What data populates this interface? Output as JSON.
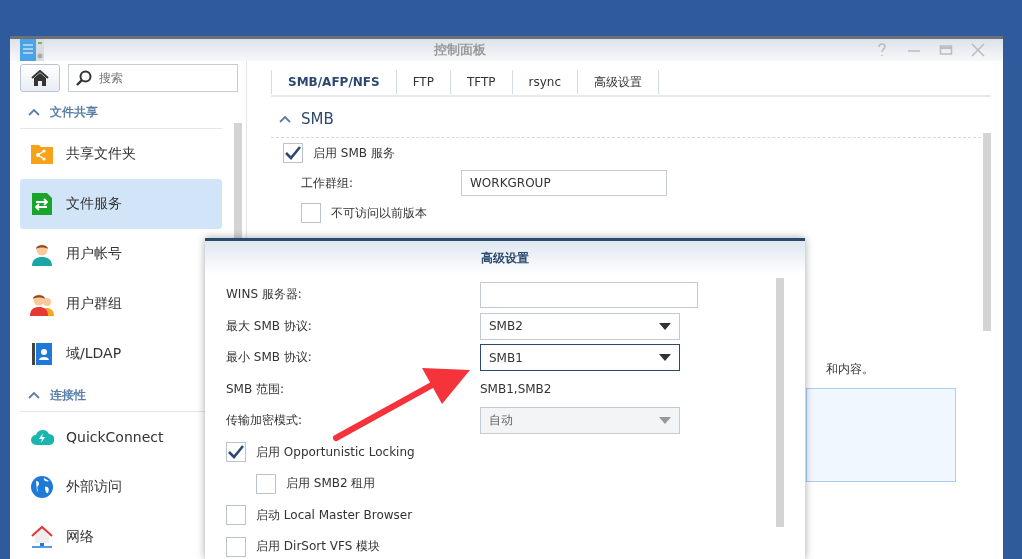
{
  "window": {
    "title": "控制面板"
  },
  "sidebar": {
    "search": {
      "placeholder": "搜索"
    },
    "groups": [
      {
        "title": "文件共享",
        "expanded": true,
        "items": [
          {
            "label": "共享文件夹",
            "selected": false
          },
          {
            "label": "文件服务",
            "selected": true
          },
          {
            "label": "用户帐号",
            "selected": false
          },
          {
            "label": "用户群组",
            "selected": false
          },
          {
            "label": "域/LDAP",
            "selected": false
          }
        ]
      },
      {
        "title": "连接性",
        "expanded": true,
        "items": [
          {
            "label": "QuickConnect",
            "selected": false
          },
          {
            "label": "外部访问",
            "selected": false
          },
          {
            "label": "网络",
            "selected": false
          }
        ]
      }
    ]
  },
  "tabs": [
    {
      "label": "SMB/AFP/NFS",
      "selected": true
    },
    {
      "label": "FTP",
      "selected": false
    },
    {
      "label": "TFTP",
      "selected": false
    },
    {
      "label": "rsync",
      "selected": false
    },
    {
      "label": "高级设置",
      "selected": false
    }
  ],
  "smb": {
    "title": "SMB",
    "expanded": true,
    "enable": {
      "label": "启用 SMB 服务",
      "checked": true
    },
    "workgroup": {
      "label": "工作群组:",
      "value": "WORKGROUP"
    },
    "previous_versions": {
      "label": "不可访问以前版本",
      "checked": false
    },
    "partial_text": "和内容。"
  },
  "dialog": {
    "title": "高级设置",
    "rows": [
      {
        "kind": "input",
        "label": "WINS 服务器:",
        "value": ""
      },
      {
        "kind": "select",
        "label": "最大 SMB 协议:",
        "value": "SMB2",
        "focused": false,
        "disabled": false
      },
      {
        "kind": "select",
        "label": "最小 SMB 协议:",
        "value": "SMB1",
        "focused": true,
        "disabled": false
      },
      {
        "kind": "text",
        "label": "SMB 范围:",
        "value": "SMB1,SMB2"
      },
      {
        "kind": "select",
        "label": "传输加密模式:",
        "value": "自动",
        "focused": false,
        "disabled": true
      },
      {
        "kind": "checkbox",
        "label": "启用 Opportunistic Locking",
        "checked": true,
        "children": [
          {
            "kind": "checkbox",
            "label": "启用 SMB2 租用",
            "checked": false
          }
        ]
      },
      {
        "kind": "checkbox",
        "label": "启动 Local Master Browser",
        "checked": false
      },
      {
        "kind": "checkbox",
        "label": "启用 DirSort VFS 模块",
        "checked": false
      }
    ]
  }
}
